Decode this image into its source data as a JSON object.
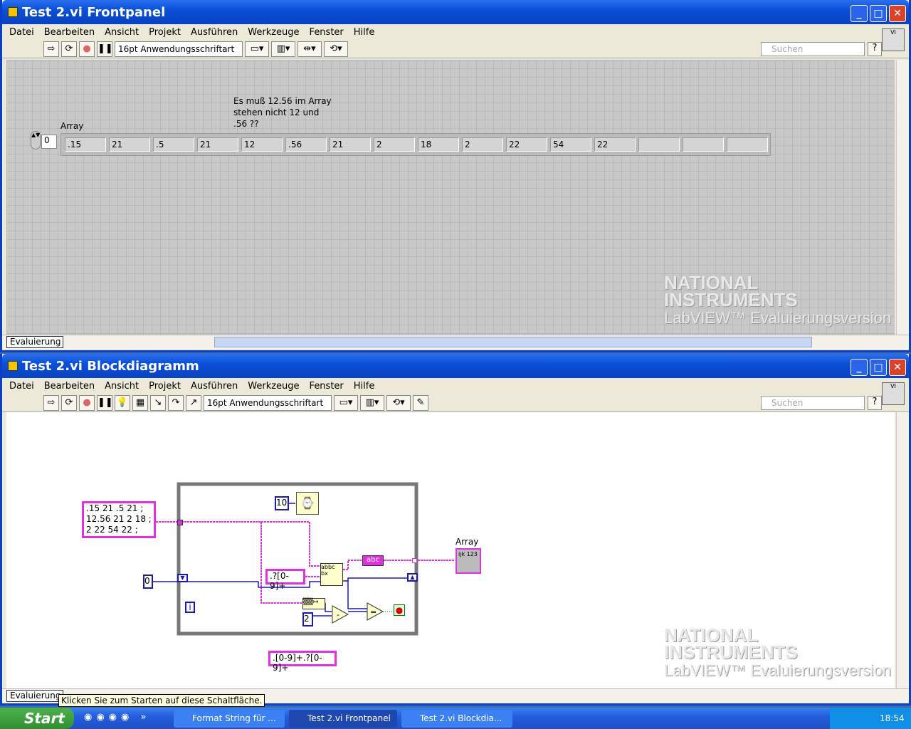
{
  "front": {
    "title": "Test 2.vi Frontpanel",
    "menu": [
      "Datei",
      "Bearbeiten",
      "Ansicht",
      "Projekt",
      "Ausführen",
      "Werkzeuge",
      "Fenster",
      "Hilfe"
    ],
    "font": "16pt Anwendungsschriftart",
    "search_placeholder": "Suchen",
    "array_label": "Array",
    "index": "0",
    "comment": "Es muß 12.56 im Array stehen nicht 12 und .56 ??",
    "values": [
      ".15",
      "21",
      ".5",
      "21",
      "12",
      ".56",
      "21",
      "2",
      "18",
      "2",
      "22",
      "54",
      "22",
      "",
      "",
      ""
    ],
    "eval": "Evaluierung"
  },
  "block": {
    "title": "Test 2.vi Blockdiagramm",
    "menu": [
      "Datei",
      "Bearbeiten",
      "Ansicht",
      "Projekt",
      "Ausführen",
      "Werkzeuge",
      "Fenster",
      "Hilfe"
    ],
    "font": "16pt Anwendungsschriftart",
    "search_placeholder": "Suchen",
    "string_const": [
      ".15 21  .5 21 ;",
      "12.56 21   2 18 ;",
      "2 22  54 22 ;"
    ],
    "wait_ms": "10",
    "regex": ".?[0-9]+",
    "regex2": ".[0-9]+.?[0-9]+",
    "init": "0",
    "two": "2",
    "iter": "i",
    "array_label": "Array",
    "abc": "abc",
    "eval": "Evaluierung",
    "tooltip": "Klicken Sie zum Starten auf diese Schaltfläche."
  },
  "watermark": {
    "l1": "NATIONAL",
    "l2": "INSTRUMENTS",
    "l3": "LabVIEW™ Evaluierungsversion"
  },
  "taskbar": {
    "start": "Start",
    "tasks": [
      "Format String für ...",
      "Test 2.vi Frontpanel",
      "Test 2.vi Blockdia..."
    ],
    "clock": "18:54"
  }
}
